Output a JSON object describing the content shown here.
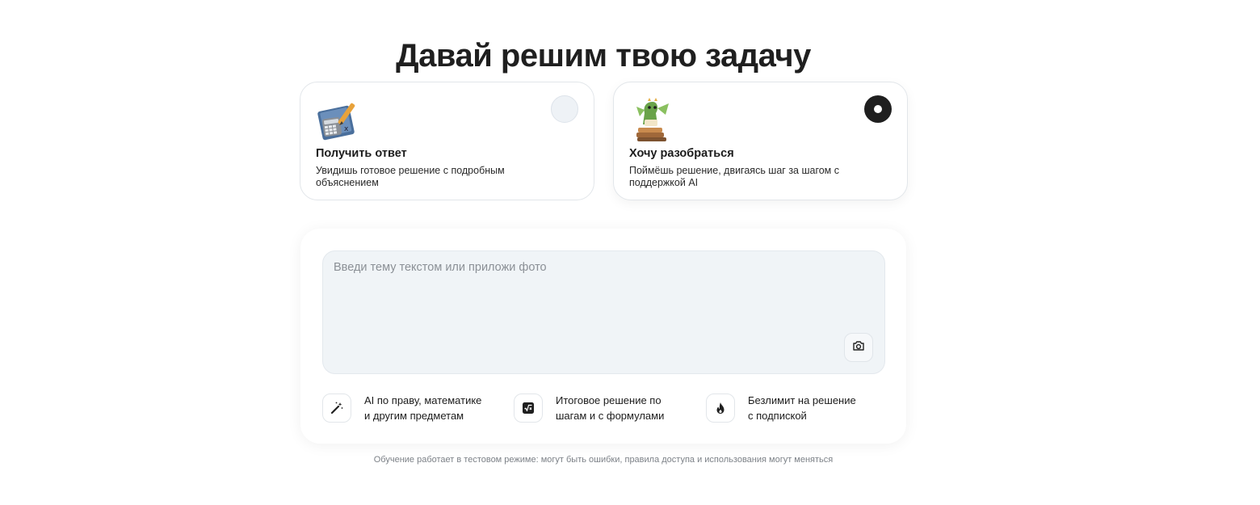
{
  "page": {
    "title": "Давай решим твою задачу",
    "disclaimer": "Обучение работает в тестовом режиме: могут быть ошибки, правила доступа и использования могут меняться"
  },
  "modes": [
    {
      "title": "Получить ответ",
      "description": "Увидишь готовое решение с подробным объяснением",
      "icon": "notebook-calculator-illustration",
      "selected": false
    },
    {
      "title": "Хочу разобраться",
      "description": "Поймёшь решение, двигаясь шаг за шагом с поддержкой AI",
      "icon": "dragon-on-books-illustration",
      "selected": true
    }
  ],
  "input": {
    "placeholder": "Введи тему текстом или приложи фото",
    "value": "",
    "camera_icon": "camera-icon"
  },
  "features": [
    {
      "icon": "magic-wand-icon",
      "line1": "AI по праву, математике",
      "line2": "и другим предметам"
    },
    {
      "icon": "square-root-icon",
      "line1": "Итоговое решение по",
      "line2": "шагам и с формулами"
    },
    {
      "icon": "fire-icon",
      "line1": "Безлимит на решение",
      "line2": "с подпиской"
    }
  ]
}
